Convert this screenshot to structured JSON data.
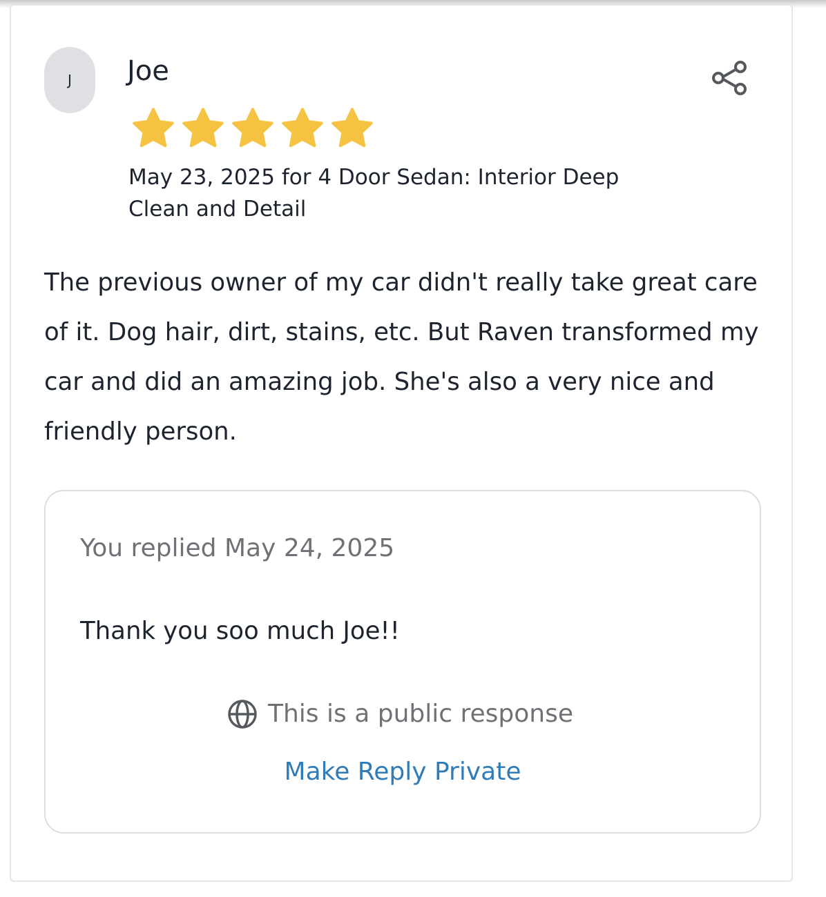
{
  "review": {
    "avatar_initial": "J",
    "reviewer_name": "Joe",
    "rating": 5,
    "rating_max": 5,
    "star_color": "#f5c242",
    "meta": "May 23, 2025 for 4 Door Sedan: Interior Deep Clean and Detail",
    "body": "The previous owner of my car didn't really take great care of it. Dog hair, dirt, stains, etc. But Raven transformed my car and did an amazing job. She's also a very nice and friendly person.",
    "share_icon": "share-icon"
  },
  "reply": {
    "date_label": "You replied May 24, 2025",
    "text": "Thank you soo much Joe!!",
    "visibility_icon": "globe-icon",
    "visibility_label": "This is a public response",
    "make_private_label": "Make Reply Private",
    "link_color": "#2f7cb8"
  }
}
